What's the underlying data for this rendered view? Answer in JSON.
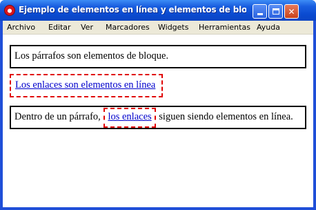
{
  "window": {
    "title": "Ejemplo de elementos en línea y elementos de bloque - O...",
    "minimize_label": "",
    "maximize_label": "",
    "close_label": "✕"
  },
  "menubar": {
    "items": [
      "Archivo",
      "Editar",
      "Ver",
      "Marcadores",
      "Widgets",
      "Herramientas",
      "Ayuda"
    ]
  },
  "content": {
    "paragraph1": "Los párrafos son elementos de bloque.",
    "link_block": "Los enlaces son elementos en línea",
    "paragraph2_before": "Dentro de un párrafo,",
    "paragraph2_link": "los enlaces",
    "paragraph2_after": "siguen siendo elementos en línea."
  },
  "colors": {
    "title_bar": "#0a4ad0",
    "menubar_bg": "#ece9d8",
    "link": "#0000cc",
    "dashed_border": "#e00000"
  }
}
